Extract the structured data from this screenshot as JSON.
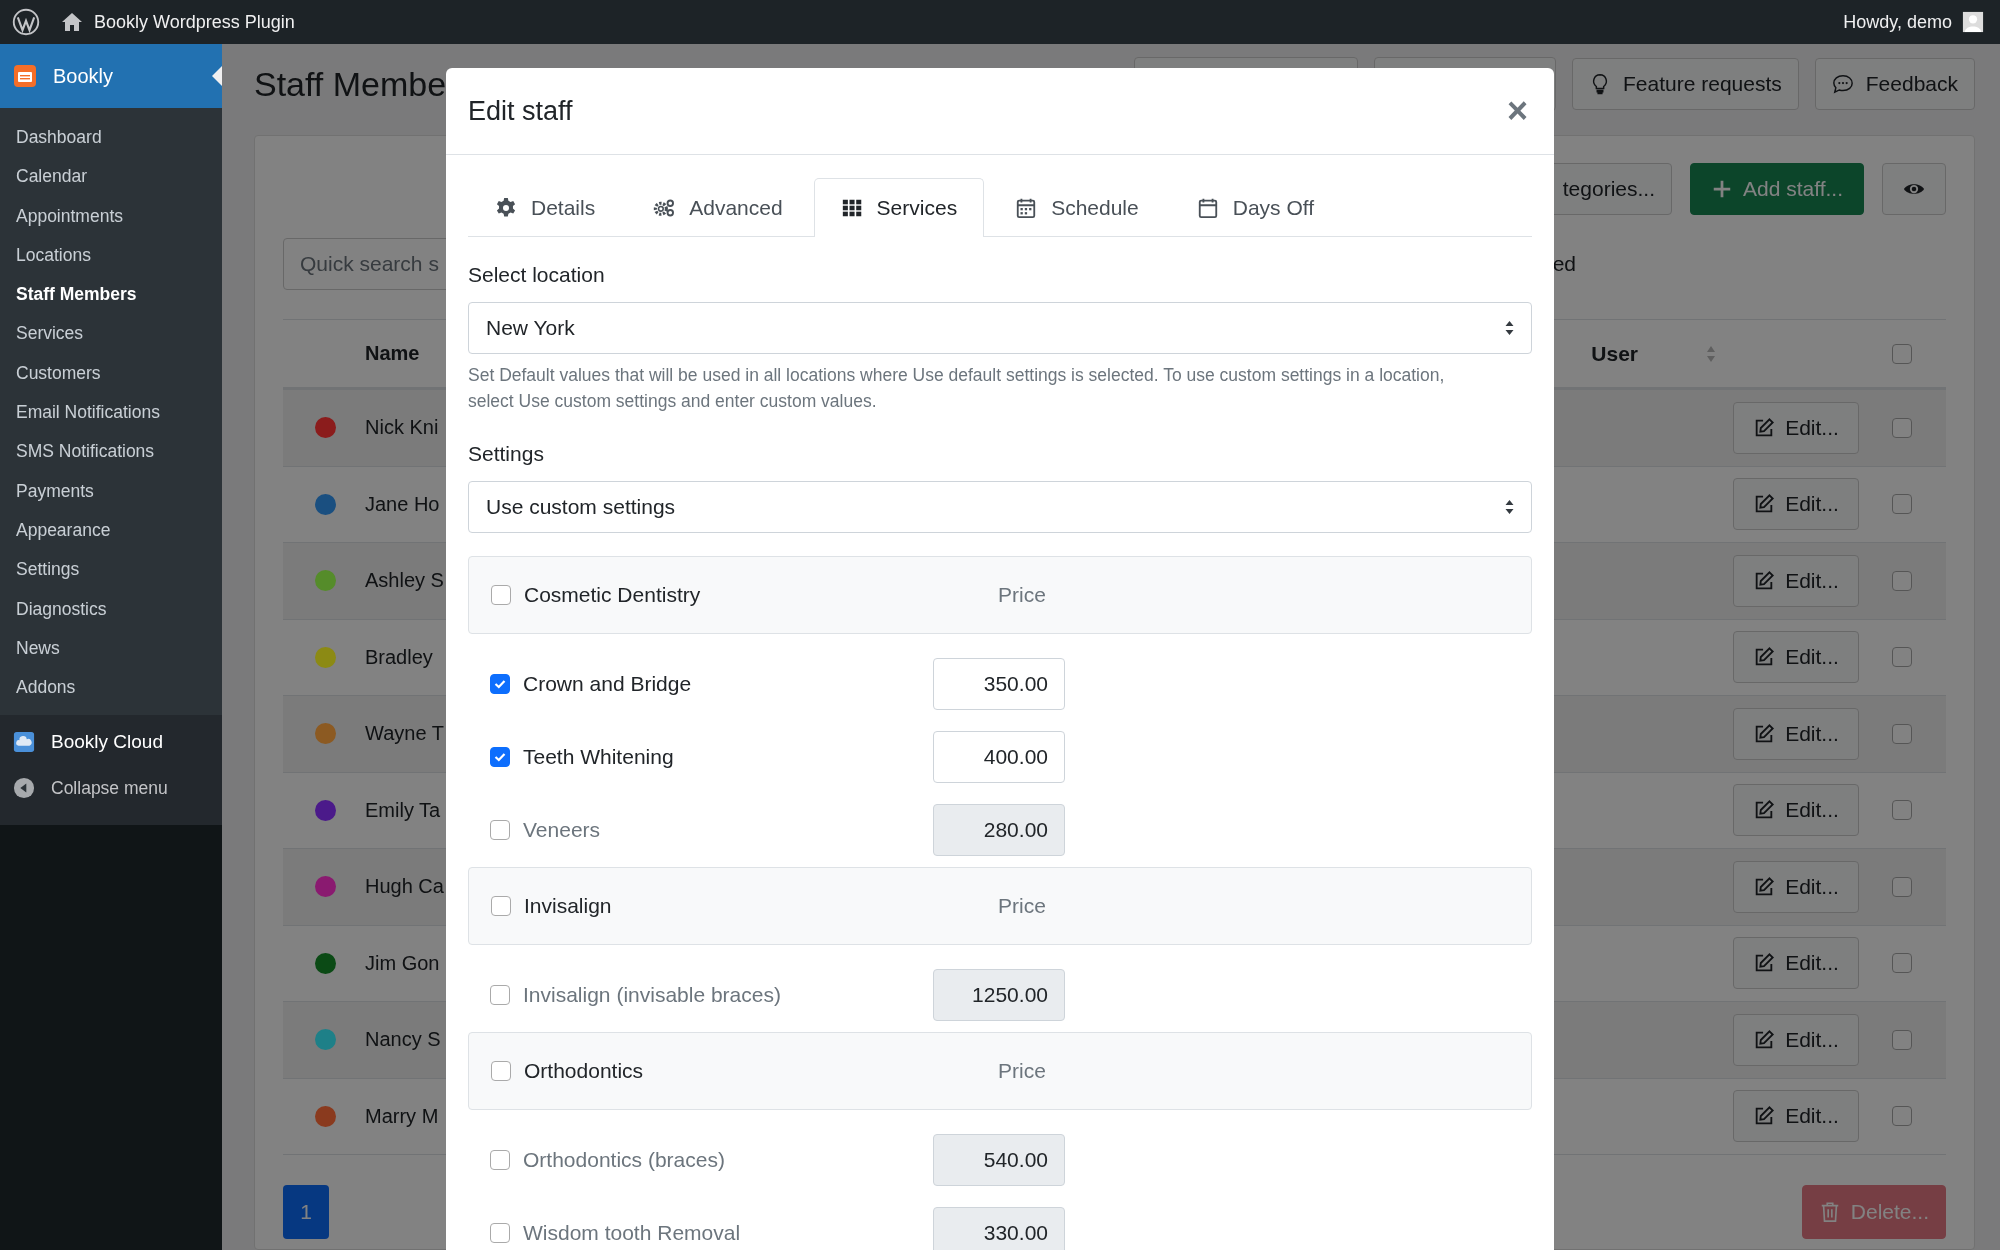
{
  "top_bar": {
    "site_name": "Bookly Wordpress Plugin",
    "greeting": "Howdy, demo"
  },
  "sidebar": {
    "plugin": {
      "label": "Bookly",
      "selected": true
    },
    "items": [
      {
        "label": "Dashboard",
        "selected": false
      },
      {
        "label": "Calendar",
        "selected": false
      },
      {
        "label": "Appointments",
        "selected": false
      },
      {
        "label": "Locations",
        "selected": false
      },
      {
        "label": "Staff Members",
        "selected": true
      },
      {
        "label": "Services",
        "selected": false
      },
      {
        "label": "Customers",
        "selected": false
      },
      {
        "label": "Email Notifications",
        "selected": false
      },
      {
        "label": "SMS Notifications",
        "selected": false
      },
      {
        "label": "Payments",
        "selected": false
      },
      {
        "label": "Appearance",
        "selected": false
      },
      {
        "label": "Settings",
        "selected": false
      },
      {
        "label": "Diagnostics",
        "selected": false
      },
      {
        "label": "News",
        "selected": false
      },
      {
        "label": "Addons",
        "selected": false
      }
    ],
    "cloud": "Bookly Cloud",
    "collapse": "Collapse menu"
  },
  "page": {
    "title": "Staff Membe",
    "header_buttons": [
      {
        "label": "Feature requests"
      },
      {
        "label": "Feedback"
      }
    ],
    "categories_button": "tegories...",
    "add_button": "Add staff...",
    "search": {
      "placeholder": "Quick search s"
    },
    "filter_text": "ed",
    "table": {
      "columns": [
        "Name",
        "User"
      ],
      "all_checked": false,
      "rows": [
        {
          "name": "Nick Kni",
          "color": "#8b1c1c",
          "edit": "Edit...",
          "checked": false
        },
        {
          "name": "Jane Ho",
          "color": "#1a4f80",
          "edit": "Edit...",
          "checked": false
        },
        {
          "name": "Ashley S",
          "color": "#558c2a",
          "edit": "Edit...",
          "checked": false
        },
        {
          "name": "Bradley",
          "color": "#8c8a14",
          "edit": "Edit...",
          "checked": false
        },
        {
          "name": "Wayne T",
          "color": "#8c5a22",
          "edit": "Edit...",
          "checked": false
        },
        {
          "name": "Emily Ta",
          "color": "#4b1a8a",
          "edit": "Edit...",
          "checked": false
        },
        {
          "name": "Hugh Ca",
          "color": "#8a1a70",
          "edit": "Edit...",
          "checked": false
        },
        {
          "name": "Jim Gon",
          "color": "#0b4a15",
          "edit": "Edit...",
          "checked": false
        },
        {
          "name": "Nancy S",
          "color": "#1e8088",
          "edit": "Edit...",
          "checked": false
        },
        {
          "name": "Marry M",
          "color": "#8a3a1e",
          "edit": "Edit...",
          "checked": false
        }
      ]
    },
    "pagination": [
      {
        "label": "1",
        "selected": true
      }
    ],
    "delete_button": "Delete..."
  },
  "modal": {
    "title": "Edit staff",
    "close": "×",
    "tabs": [
      {
        "label": "Details",
        "selected": false
      },
      {
        "label": "Advanced",
        "selected": false
      },
      {
        "label": "Services",
        "selected": true
      },
      {
        "label": "Schedule",
        "selected": false
      },
      {
        "label": "Days Off",
        "selected": false
      }
    ],
    "location_label": "Select location",
    "location_value": "New York",
    "help": "Set Default values that will be used in all locations where Use default settings is selected. To use custom settings in a location, select Use custom settings and enter custom values.",
    "settings_label": "Settings",
    "settings_value": "Use custom settings",
    "categories": [
      {
        "name": "Cosmetic Dentistry",
        "checked": false,
        "price_header": "Price",
        "services": [
          {
            "name": "Crown and Bridge",
            "checked": true,
            "price": "350.00"
          },
          {
            "name": "Teeth Whitening",
            "checked": true,
            "price": "400.00"
          },
          {
            "name": "Veneers",
            "checked": false,
            "price": "280.00"
          }
        ]
      },
      {
        "name": "Invisalign",
        "checked": false,
        "price_header": "Price",
        "services": [
          {
            "name": "Invisalign (invisable braces)",
            "checked": false,
            "price": "1250.00"
          }
        ]
      },
      {
        "name": "Orthodontics",
        "checked": false,
        "price_header": "Price",
        "services": [
          {
            "name": "Orthodontics (braces)",
            "checked": false,
            "price": "540.00"
          },
          {
            "name": "Wisdom tooth Removal",
            "checked": false,
            "price": "330.00"
          }
        ]
      }
    ]
  }
}
